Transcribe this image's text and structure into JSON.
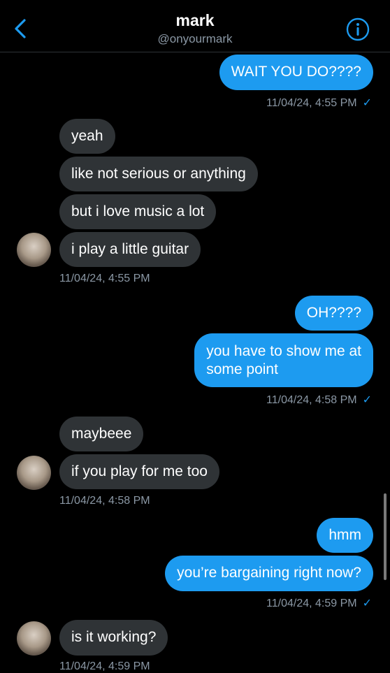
{
  "header": {
    "name": "mark",
    "handle": "@onyourmark"
  },
  "colors": {
    "accent": "#1d9bf0",
    "incoming_bubble": "#2f3336",
    "background": "#000000",
    "timestamp": "#8b98a5"
  },
  "icons": {
    "back": "chevron-left-icon",
    "info": "info-circle-icon",
    "read": "check-icon"
  },
  "messages": {
    "m1": "WAIT YOU DO????",
    "t1": "11/04/24, 4:55 PM",
    "m2": "yeah",
    "m3": "like not serious or anything",
    "m4": "but i love music a lot",
    "m5": "i play a little guitar",
    "t2": "11/04/24, 4:55 PM",
    "m6": "OH????",
    "m7_line1": "you have to show me at",
    "m7_line2": "some point",
    "t3": "11/04/24, 4:58 PM",
    "m8": "maybeee",
    "m9": "if you play for me too",
    "t4": "11/04/24, 4:58 PM",
    "m10": "hmm",
    "m11": "you’re bargaining right now?",
    "t5": "11/04/24, 4:59 PM",
    "m12": "is it working?",
    "t6": "11/04/24, 4:59 PM",
    "check_glyph": "✓"
  }
}
